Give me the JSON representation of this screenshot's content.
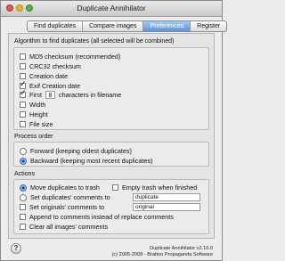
{
  "window": {
    "title": "Duplicate Annihilator"
  },
  "tabs": [
    {
      "label": "Find duplicates",
      "active": false
    },
    {
      "label": "Compare images",
      "active": false
    },
    {
      "label": "Preferences",
      "active": true
    },
    {
      "label": "Register",
      "active": false
    }
  ],
  "algorithm": {
    "title": "Algorithm to find duplicates (all selected will be combined)",
    "md5": {
      "label": "MD5 checksum (recommended)",
      "checked": false
    },
    "crc32": {
      "label": "CRC32 checksum",
      "checked": false
    },
    "creation_date": {
      "label": "Creation date",
      "checked": false
    },
    "exif": {
      "label": "Exif Creation date",
      "checked": true
    },
    "first": {
      "label_before": "First",
      "value": "8",
      "label_after": "characters in filename",
      "checked": true
    },
    "width": {
      "label": "Width",
      "checked": false
    },
    "height": {
      "label": "Height",
      "checked": false
    },
    "file_size": {
      "label": "File size",
      "checked": false
    }
  },
  "process_order": {
    "title": "Process order",
    "forward": {
      "label": "Forward (keeping oldest duplicates)",
      "selected": false
    },
    "backward": {
      "label": "Backward (keeping most recent duplicates)",
      "selected": true
    }
  },
  "actions": {
    "title": "Actions",
    "move_trash": {
      "label": "Move duplicates to trash",
      "selected": true
    },
    "empty_trash": {
      "label": "Empty trash when finished",
      "checked": false
    },
    "set_dup_comments": {
      "label": "Set duplicates' comments to",
      "selected": false,
      "value": "duplicate"
    },
    "set_orig_comments": {
      "label": "Set originals' comments to",
      "checked": false,
      "value": "original"
    },
    "append_comments": {
      "label": "Append to comments instead of replace comments",
      "checked": false
    },
    "clear_comments": {
      "label": "Clear all images' comments",
      "checked": false
    }
  },
  "footer": {
    "version": "Duplicate Annihilator v2.15.0",
    "copyright": "(c) 2005-2008 - Brattoo Propaganda Software"
  },
  "help": {
    "label": "?"
  }
}
